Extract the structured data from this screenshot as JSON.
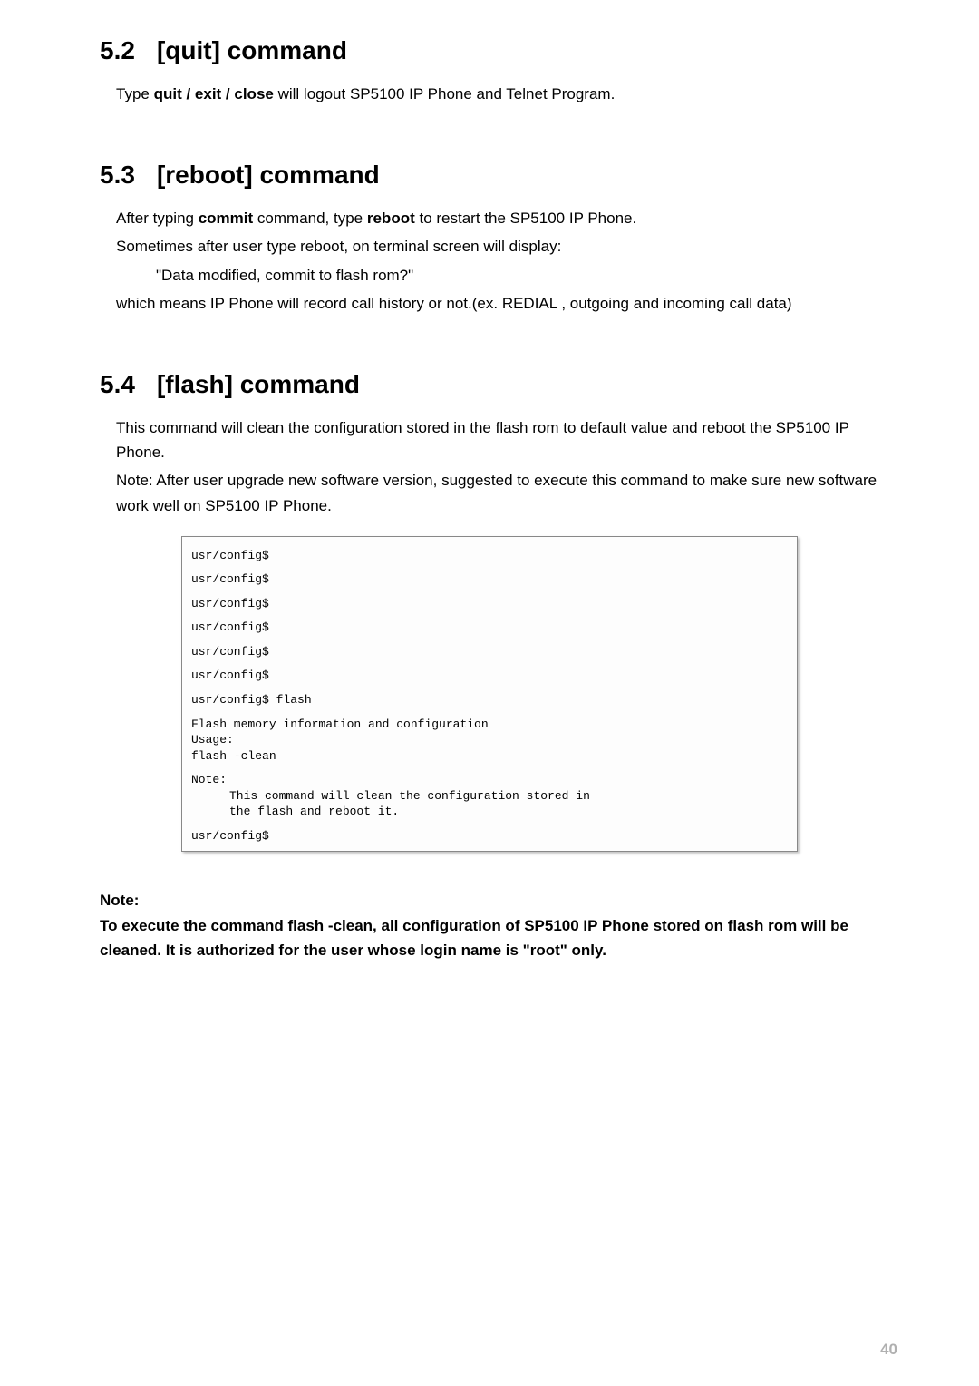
{
  "sections": [
    {
      "number": "5.2",
      "title": "[quit] command",
      "body": {
        "line1_prefix": "Type ",
        "line1_bold": "quit / exit / close",
        "line1_suffix": " will logout SP5100 IP Phone and Telnet Program."
      }
    },
    {
      "number": "5.3",
      "title": "[reboot] command",
      "body": {
        "line1_prefix": "After typing ",
        "line1_bold1": "commit",
        "line1_mid": " command, type ",
        "line1_bold2": "reboot",
        "line1_suffix": " to restart the SP5100 IP Phone.",
        "line2": "Sometimes after user type reboot, on terminal screen will display:",
        "line3": "\"Data modified, commit to flash rom?\"",
        "line4": "which means IP Phone will record call history or not.(ex. REDIAL , outgoing and incoming call data)"
      }
    },
    {
      "number": "5.4",
      "title": "[flash] command",
      "body": {
        "line1": "This command will clean the configuration stored in the flash rom to default value and reboot the SP5100 IP Phone.",
        "line2_prefix": "N",
        "line2_rest": "ote: After user upgrade new software version, suggested to execute this command to make sure new software work well on SP5100 IP Phone."
      }
    }
  ],
  "terminal": {
    "l1": "usr/config$",
    "l2": "usr/config$",
    "l3": "usr/config$",
    "l4": "usr/config$",
    "l5": "usr/config$",
    "l6": "usr/config$",
    "l7": "usr/config$ flash",
    "l8": "Flash memory information and configuration",
    "l9": "Usage:",
    "l10": "flash -clean",
    "l11": "Note:",
    "l12": "This command will clean the configuration stored in",
    "l13": "the flash and reboot it.",
    "l14": "usr/config$"
  },
  "note": {
    "label": "Note:",
    "text": "To execute the command flash -clean, all configuration of SP5100 IP Phone stored on flash rom will be cleaned. It is authorized for the user whose login name is \"root\" only."
  },
  "page_number": "40"
}
